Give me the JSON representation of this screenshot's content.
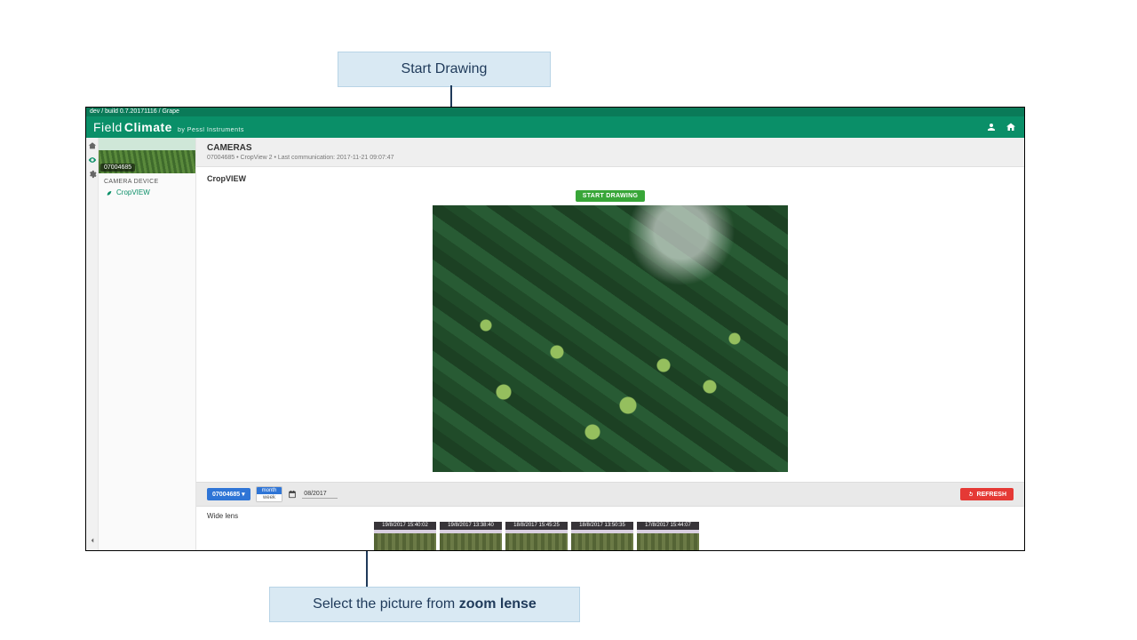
{
  "annotations": {
    "top": "Start Drawing",
    "bottom_prefix": "Select the picture from ",
    "bottom_bold": "zoom lense"
  },
  "buildbar": "dev / build 0.7.20171116 / Grape",
  "brand": {
    "part1": "Field",
    "part2": "Climate",
    "byline": "by Pessl Instruments"
  },
  "station": {
    "id": "07004685",
    "section": "CAMERA DEVICE",
    "item": "CropVIEW"
  },
  "cameras": {
    "title": "CAMERAS",
    "subtitle": "07004685 • CropView 2 • Last communication: 2017-11-21 09:07:47"
  },
  "panel_label": "CropVIEW",
  "start_drawing": "START DRAWING",
  "filter": {
    "station_pill": "07004685 ▾",
    "toggle_on": "month",
    "toggle_off": "week",
    "date": "08/2017",
    "refresh": "REFRESH"
  },
  "strip": {
    "label": "Wide lens",
    "thumbs": [
      "19/8/2017 15:40:02",
      "19/8/2017 13:38:40",
      "18/8/2017 15:45:25",
      "18/8/2017 13:50:35",
      "17/8/2017 15:44:07"
    ]
  }
}
